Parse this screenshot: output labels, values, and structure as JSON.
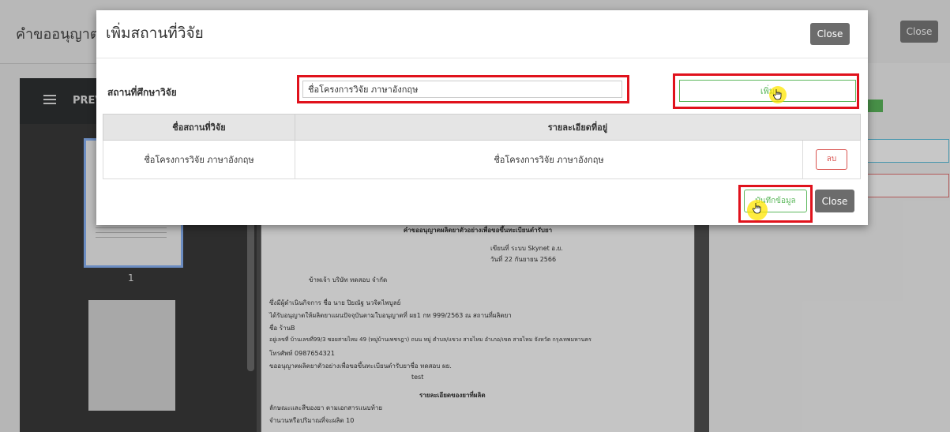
{
  "background": {
    "page_title": "คำขออนุญาต",
    "close_label": "Close",
    "pdf_label": "PREV",
    "thumbnail_page_number": "1",
    "document": {
      "heading": "คำขออนุญาตผลิตยาตัวอย่างเพื่อขอขึ้นทะเบียนตำรับยา",
      "lines": [
        "เขียนที่ ระบบ Skynet อ.ย.",
        "วันที่ 22 กันยายน 2566",
        "ข้าพเจ้า บริษัท ทดสอบ จำกัด",
        "ซึ่งมีผู้ดำเนินกิจการ ชื่อ นาย ปิยณัฐ นวจิตไพบูลย์",
        "ได้รับอนุญาตให้ผลิตยาแผนปัจจุบันตามใบอนุญาตที่ ผย1 กท 999/2563 ณ สถานที่ผลิตยา",
        "ชื่อ ร้านB",
        "อยู่เลขที่ บ้านเลขที่99/3 ซอยสายไหม 49 (หมู่บ้านเพชรฎา) ถนน หมู่ ตำบล/แขวง สายไหม อำเภอ/เขต สายไหม จังหวัด กรุงเทพมหานคร",
        "โทรศัพท์ 0987654321",
        "ขออนุญาตผลิตยาตัวอย่างเพื่อขอขึ้นทะเบียนตำรับยาชื่อ ทดสอบ ผย.",
        "test",
        "รายละเอียดของยาที่ผลิต",
        "ลักษณะและสีของยา ตามเอกสารแนบท้าย",
        "จำนวนหรือปริมาณที่จะผลิต 10"
      ]
    }
  },
  "modal": {
    "title": "เพิ่มสถานที่วิจัย",
    "close_top_label": "Close",
    "field_label": "สถานที่ศึกษาวิจัย",
    "input_value": "ชื่อโครงการวิจัย ภาษาอังกฤษ",
    "add_button_label": "เพิ่ม",
    "table": {
      "headers": [
        "ชื่อสถานที่วิจัย",
        "รายละเอียดที่อยู่"
      ],
      "rows": [
        {
          "name": "ชื่อโครงการวิจัย ภาษาอังกฤษ",
          "detail": "ชื่อโครงการวิจัย ภาษาอังกฤษ",
          "delete_label": "ลบ"
        }
      ]
    },
    "save_button_label": "บันทึกข้อมูล",
    "close_bottom_label": "Close"
  },
  "colors": {
    "highlight": "#e0121c",
    "success": "#5cb85c",
    "danger": "#d9534f",
    "close_button": "#6c6c6c"
  }
}
